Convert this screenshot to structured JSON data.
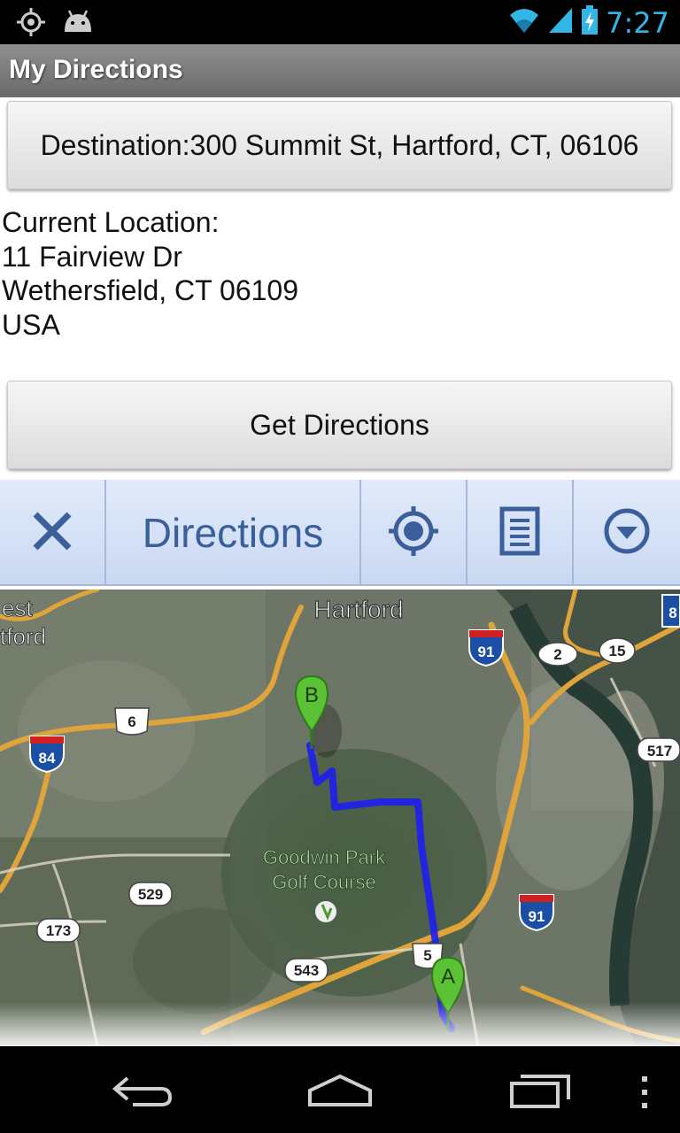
{
  "status_bar": {
    "time": "7:27",
    "icons": [
      "gps-icon",
      "android-icon",
      "wifi-icon",
      "signal-icon",
      "battery-charging-icon"
    ],
    "accent_color": "#33b5e5"
  },
  "app": {
    "title": "My Directions"
  },
  "destination_button": {
    "label": "Destination:300 Summit St, Hartford, CT, 06106"
  },
  "current_location": {
    "label": "Current Location:",
    "street": "11 Fairview Dr",
    "city": "Wethersfield, CT 06109",
    "country": "USA"
  },
  "get_directions_button": {
    "label": "Get Directions"
  },
  "directions_bar": {
    "label": "Directions",
    "icons": [
      "close-icon",
      "my-location-icon",
      "list-icon",
      "dropdown-icon"
    ],
    "color": "#3b5f9a"
  },
  "map": {
    "labels": {
      "city": "Hartford",
      "west_hartford_1": "est",
      "west_hartford_2": "tford",
      "park_1": "Goodwin Park",
      "park_2": "Golf Course"
    },
    "shields": {
      "i91_top": "91",
      "i91_bottom": "91",
      "i84": "84",
      "us6": "6",
      "us5": "5",
      "r2": "2",
      "r15": "15",
      "r517": "517",
      "r529": "529",
      "r173": "173",
      "r543": "543",
      "r8": "8"
    },
    "markers": {
      "start": "A",
      "end": "B"
    },
    "route_color": "#1e1ef0"
  },
  "nav_bar": {
    "icons": [
      "back-icon",
      "home-icon",
      "recent-apps-icon",
      "overflow-menu-icon"
    ]
  }
}
